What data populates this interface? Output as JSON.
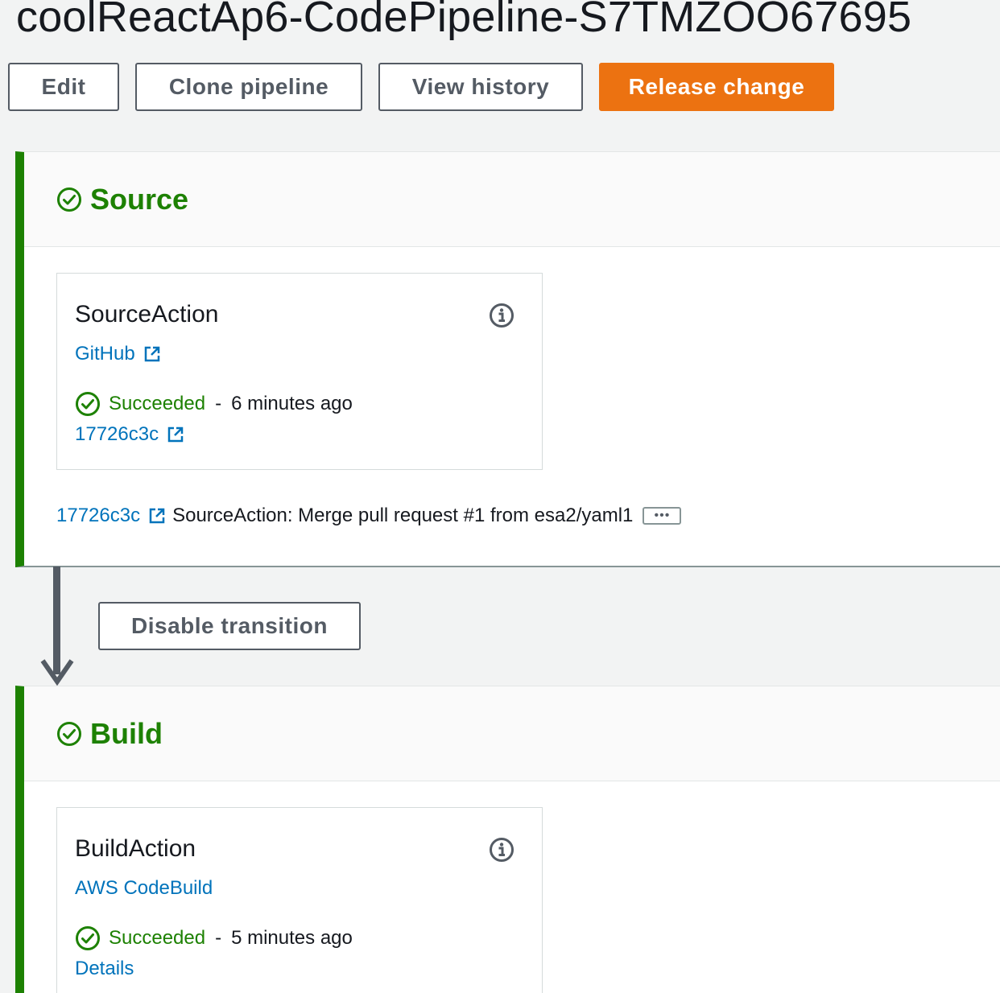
{
  "page": {
    "title": "coolReactAp6-CodePipeline-S7TMZOO67695"
  },
  "toolbar": {
    "edit_label": "Edit",
    "clone_label": "Clone pipeline",
    "history_label": "View history",
    "release_label": "Release change"
  },
  "colors": {
    "success": "#1d8102",
    "link": "#0073bb",
    "primary": "#ec7211"
  },
  "stages": [
    {
      "name": "Source",
      "status_icon": "check-circle-icon",
      "action": {
        "name": "SourceAction",
        "provider": "GitHub",
        "status": "Succeeded",
        "separator": "-",
        "time": "6 minutes ago",
        "link": "17726c3c"
      },
      "commit": {
        "id": "17726c3c",
        "message": "SourceAction: Merge pull request #1 from esa2/yaml1",
        "more": "•••"
      }
    },
    {
      "name": "Build",
      "status_icon": "check-circle-icon",
      "action": {
        "name": "BuildAction",
        "provider": "AWS CodeBuild",
        "status": "Succeeded",
        "separator": "-",
        "time": "5 minutes ago",
        "link": "Details"
      }
    }
  ],
  "transition": {
    "button_label": "Disable transition"
  }
}
